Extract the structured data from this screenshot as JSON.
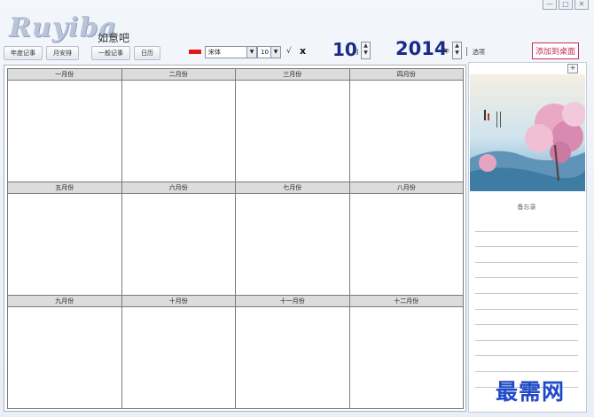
{
  "app": {
    "logo": "Ruyiba",
    "subtitle": "如意吧"
  },
  "window_controls": [
    "—",
    "□",
    "✕"
  ],
  "toolbar": {
    "tabs": [
      "年度记事",
      "月安排",
      "一般记事",
      "日历"
    ],
    "font_color": "#e01818",
    "font_name": "宋体",
    "font_size": "10",
    "check": "√",
    "clear": "x",
    "month": "10",
    "month_unit": "月",
    "year": "2014",
    "year_unit": "年",
    "options": "选项",
    "add_desktop": "添加到桌面"
  },
  "calendar": {
    "months": [
      "一月份",
      "二月份",
      "三月份",
      "四月份",
      "五月份",
      "六月份",
      "七月份",
      "八月份",
      "九月份",
      "十月份",
      "十一月份",
      "十二月份"
    ]
  },
  "sidebar": {
    "add": "+",
    "memo_title": "备忘录",
    "memo_line_count": 11
  },
  "watermark": "最需网"
}
